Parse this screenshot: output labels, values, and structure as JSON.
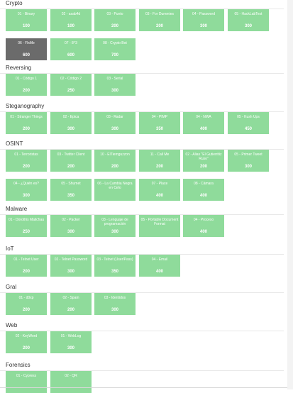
{
  "categories": [
    {
      "title": "Crypto",
      "challenges": [
        {
          "name": "01 - Binary",
          "points": "100",
          "solved": false
        },
        {
          "name": "02 - asab4d",
          "points": "100",
          "solved": false
        },
        {
          "name": "03 - Punto",
          "points": "200",
          "solved": false
        },
        {
          "name": "03 - For Dummies",
          "points": "200",
          "solved": false
        },
        {
          "name": "04 - Password",
          "points": "300",
          "solved": false
        },
        {
          "name": "05 - HackLabTest",
          "points": "300",
          "solved": false
        },
        {
          "name": "06 - FlxMe",
          "points": "600",
          "solved": true
        },
        {
          "name": "07 - 8^3",
          "points": "600",
          "solved": false
        },
        {
          "name": "08 - Crypto Bot",
          "points": "700",
          "solved": false
        }
      ]
    },
    {
      "title": "Reversing",
      "challenges": [
        {
          "name": "01 - Código 1",
          "points": "200",
          "solved": false
        },
        {
          "name": "02 - Código 2",
          "points": "250",
          "solved": false
        },
        {
          "name": "03 - Serial",
          "points": "300",
          "solved": false
        }
      ]
    },
    {
      "title": "Steganography",
      "challenges": [
        {
          "name": "01 - Stranger Things",
          "points": "200",
          "solved": false
        },
        {
          "name": "02 - Epica",
          "points": "300",
          "solved": false
        },
        {
          "name": "03 - Radar",
          "points": "300",
          "solved": false
        },
        {
          "name": "04 - PIMP",
          "points": "350",
          "solved": false
        },
        {
          "name": "04 - NWA",
          "points": "400",
          "solved": false
        },
        {
          "name": "05 - Kush Ups",
          "points": "450",
          "solved": false
        }
      ]
    },
    {
      "title": "OSINT",
      "challenges": [
        {
          "name": "01 - Terroristas",
          "points": "200",
          "solved": false
        },
        {
          "name": "03 - Twitter Client",
          "points": "200",
          "solved": false
        },
        {
          "name": "10 - ElTiemguzzon",
          "points": "200",
          "solved": false
        },
        {
          "name": "11 - Call Me",
          "points": "200",
          "solved": false
        },
        {
          "name": "02 - Alias \"El Gutierritiz Ruso\"",
          "points": "200",
          "solved": false
        },
        {
          "name": "05 - Primer Tweet",
          "points": "300",
          "solved": false
        },
        {
          "name": "04 - ¿Quién es?",
          "points": "300",
          "solved": false
        },
        {
          "name": "05 - Shumet",
          "points": "350",
          "solved": false
        },
        {
          "name": "06 - La Cambia Negra en Celo",
          "points": "",
          "solved": false
        },
        {
          "name": "07 - Place",
          "points": "400",
          "solved": false
        },
        {
          "name": "08 - Cámara",
          "points": "400",
          "solved": false
        }
      ]
    },
    {
      "title": "Malware",
      "challenges": [
        {
          "name": "01 - Dorothis Malichau",
          "points": "250",
          "solved": false
        },
        {
          "name": "02 - Packer",
          "points": "300",
          "solved": false
        },
        {
          "name": "03 - Lenguaje de programación",
          "points": "300",
          "solved": false
        },
        {
          "name": "05 - Portable Document Format",
          "points": "",
          "solved": false
        },
        {
          "name": "04 - Proceso",
          "points": "400",
          "solved": false
        }
      ]
    },
    {
      "title": "IoT",
      "challenges": [
        {
          "name": "01 - Telnet User",
          "points": "200",
          "solved": false
        },
        {
          "name": "02 - Telnet Password",
          "points": "300",
          "solved": false
        },
        {
          "name": "03 - Telnet (User/Pass)",
          "points": "350",
          "solved": false
        },
        {
          "name": "04 - Email",
          "points": "400",
          "solved": false
        }
      ]
    },
    {
      "title": "Gral",
      "challenges": [
        {
          "name": "01 - d0xp",
          "points": "200",
          "solved": false
        },
        {
          "name": "02 - Spam",
          "points": "200",
          "solved": false
        },
        {
          "name": "03 - Identidos",
          "points": "300",
          "solved": false
        }
      ]
    },
    {
      "title": "Web",
      "challenges": [
        {
          "name": "02 - KeyWord",
          "points": "200",
          "solved": false
        },
        {
          "name": "01 - WebLog",
          "points": "300",
          "solved": false
        }
      ]
    },
    {
      "title": "Forensics",
      "challenges": [
        {
          "name": "01 - Cypress",
          "points": "",
          "solved": false
        },
        {
          "name": "02 - QR",
          "points": "",
          "solved": false
        }
      ]
    }
  ],
  "colors": {
    "card": "#8fdb9b",
    "card_solved": "#6b6b6b"
  }
}
